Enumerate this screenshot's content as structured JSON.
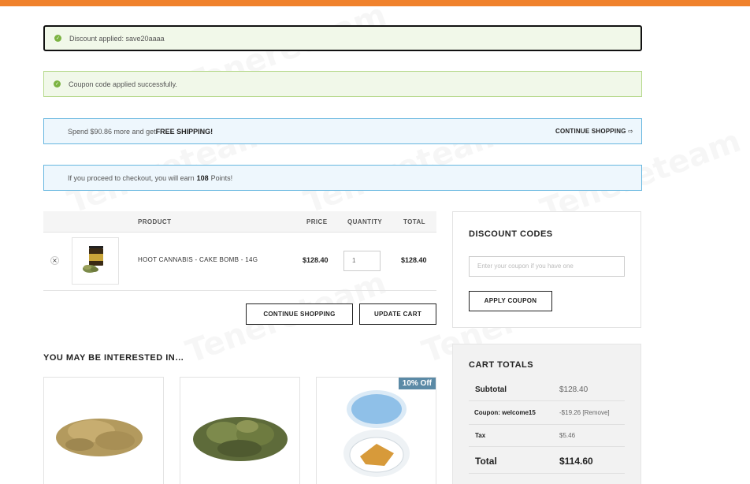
{
  "notices": {
    "discount_applied": "Discount applied: save20aaaa",
    "coupon_applied": "Coupon code applied successfully.",
    "shipping_prefix": "Spend $90.86 more and get ",
    "shipping_bold": "FREE SHIPPING!",
    "continue_shopping_link": "CONTINUE SHOPPING",
    "points_prefix": "If you proceed to checkout, you will earn ",
    "points_value": "108",
    "points_suffix": " Points!"
  },
  "cart": {
    "headers": {
      "product": "PRODUCT",
      "price": "PRICE",
      "quantity": "QUANTITY",
      "total": "TOTAL"
    },
    "items": [
      {
        "name": "HOOT CANNABIS - CAKE BOMB - 14G",
        "price": "$128.40",
        "quantity": "1",
        "total": "$128.40",
        "remove": "×"
      }
    ],
    "continue_button": "CONTINUE SHOPPING",
    "update_button": "UPDATE CART"
  },
  "interested": {
    "title": "YOU MAY BE INTERESTED IN…",
    "badge": "10% Off"
  },
  "discount": {
    "title": "DISCOUNT CODES",
    "placeholder": "Enter your coupon if you have one",
    "apply_button": "APPLY COUPON"
  },
  "totals": {
    "title": "CART TOTALS",
    "subtotal_label": "Subtotal",
    "subtotal_value": "$128.40",
    "coupon_label": "Coupon: welcome15",
    "coupon_value": "-$19.26",
    "coupon_remove": "[Remove]",
    "tax_label": "Tax",
    "tax_value": "$5.46",
    "total_label": "Total",
    "total_value": "$114.60"
  },
  "watermark": "Tenereteam",
  "colors": {
    "accent": "#f0822d",
    "success_bg": "#f1f8e9",
    "info_border": "#67b7e0",
    "badge": "#5b8aa6"
  }
}
